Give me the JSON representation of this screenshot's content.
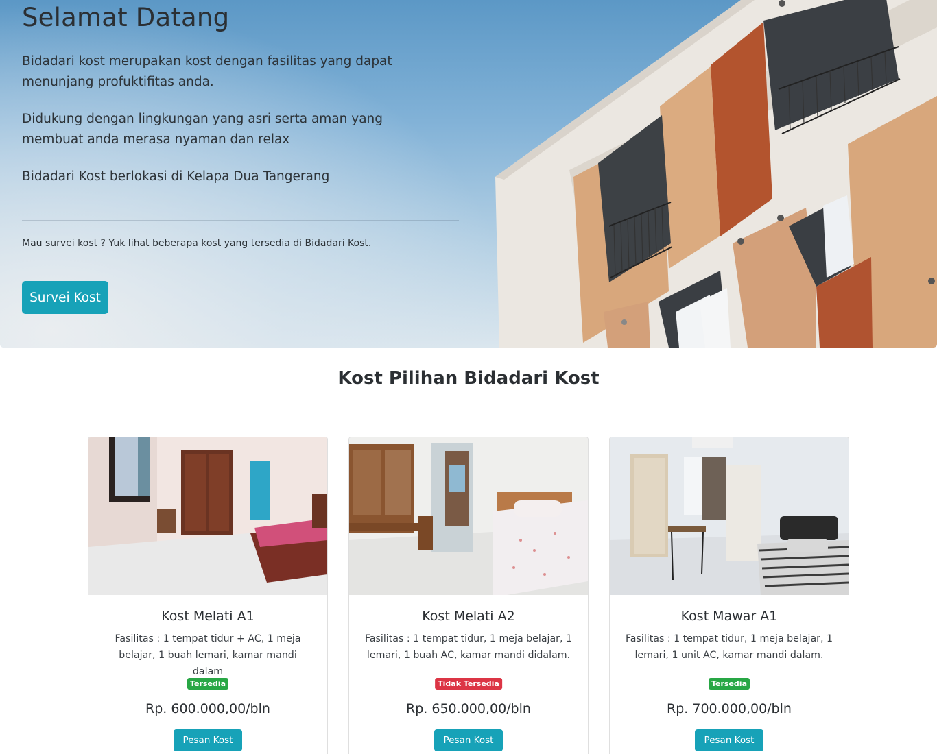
{
  "hero": {
    "title": "Selamat Datang",
    "paragraph1": "Bidadari kost merupakan kost dengan fasilitas yang dapat menunjang profuktifitas anda.",
    "paragraph2": "Didukung dengan lingkungan yang asri serta aman yang membuat anda merasa nyaman dan relax",
    "paragraph3": "Bidadari Kost berlokasi di Kelapa Dua Tangerang",
    "survey_text": "Mau survei kost ? Yuk lihat beberapa kost yang tersedia di Bidadari Kost.",
    "button_label": "Survei Kost",
    "image_icon": "building-photo"
  },
  "section": {
    "title": "Kost Pilihan Bidadari Kost"
  },
  "cards": [
    {
      "name": "Kost Melati A1",
      "facilities": "Fasilitas : 1 tempat tidur + AC, 1 meja belajar, 1 buah lemari, kamar mandi dalam",
      "status": "Tersedia",
      "price": "Rp. 600.000,00/bln",
      "button_label": "Pesan Kost"
    },
    {
      "name": "Kost Melati A2",
      "facilities": "Fasilitas : 1 tempat tidur, 1 meja belajar, 1 lemari, 1 buah AC, kamar mandi didalam.",
      "status": "Tidak Tersedia",
      "price": "Rp. 650.000,00/bln",
      "button_label": "Pesan Kost"
    },
    {
      "name": "Kost Mawar A1",
      "facilities": "Fasilitas : 1 tempat tidur, 1 meja belajar, 1 lemari, 1 unit AC, kamar mandi dalam.",
      "status": "Tersedia",
      "price": "Rp. 700.000,00/bln",
      "button_label": "Pesan Kost"
    }
  ],
  "colors": {
    "accent": "#17a2b8",
    "available": "#28a745",
    "unavailable": "#dc3545"
  }
}
